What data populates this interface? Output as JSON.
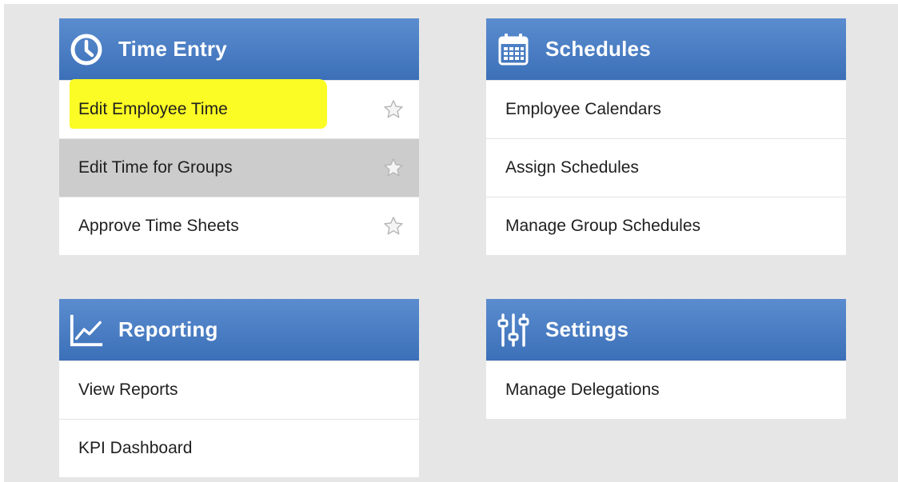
{
  "panels": [
    {
      "title": "Time Entry",
      "icon": "clock-icon",
      "items": [
        {
          "label": "Edit Employee Time",
          "favorite": true,
          "highlighted": true
        },
        {
          "label": "Edit Time for Groups",
          "favorite": true,
          "hovered": true
        },
        {
          "label": "Approve Time Sheets",
          "favorite": true
        }
      ]
    },
    {
      "title": "Schedules",
      "icon": "calendar-icon",
      "items": [
        {
          "label": "Employee Calendars"
        },
        {
          "label": "Assign Schedules"
        },
        {
          "label": "Manage Group Schedules"
        }
      ]
    },
    {
      "title": "Reporting",
      "icon": "line-chart-icon",
      "items": [
        {
          "label": "View Reports"
        },
        {
          "label": "KPI Dashboard"
        }
      ]
    },
    {
      "title": "Settings",
      "icon": "sliders-icon",
      "items": [
        {
          "label": "Manage Delegations"
        }
      ]
    }
  ],
  "colors": {
    "header_top": "#5b8ccf",
    "header_bottom": "#3b70b8",
    "hover_row": "#cccccc",
    "highlight": "#fbfb25",
    "background": "#e6e6e6"
  }
}
